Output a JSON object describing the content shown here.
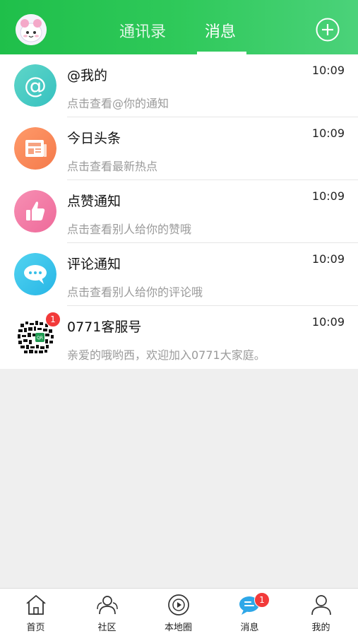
{
  "header": {
    "tabs": [
      {
        "label": "通讯录"
      },
      {
        "label": "消息"
      }
    ],
    "active_tab": "消息",
    "accent_color": "#2fc95a"
  },
  "messages": [
    {
      "icon": "at-icon",
      "title": "@我的",
      "subtitle": "点击查看@你的通知",
      "time": "10:09"
    },
    {
      "icon": "newspaper-icon",
      "title": "今日头条",
      "subtitle": "点击查看最新热点",
      "time": "10:09"
    },
    {
      "icon": "thumbs-up-icon",
      "title": "点赞通知",
      "subtitle": "点击查看别人给你的赞哦",
      "time": "10:09"
    },
    {
      "icon": "comment-bubble-icon",
      "title": "评论通知",
      "subtitle": "点击查看别人给你的评论哦",
      "time": "10:09"
    },
    {
      "icon": "qr-code-avatar",
      "title": "0771客服号",
      "subtitle": "亲爱的哦哟西，欢迎加入0771大家庭。",
      "time": "10:09",
      "badge": "1"
    }
  ],
  "bottom_nav": [
    {
      "icon": "home-icon",
      "label": "首页"
    },
    {
      "icon": "community-icon",
      "label": "社区"
    },
    {
      "icon": "local-circle-icon",
      "label": "本地圈"
    },
    {
      "icon": "message-icon",
      "label": "消息",
      "badge": "1",
      "active": true
    },
    {
      "icon": "profile-icon",
      "label": "我的"
    }
  ]
}
